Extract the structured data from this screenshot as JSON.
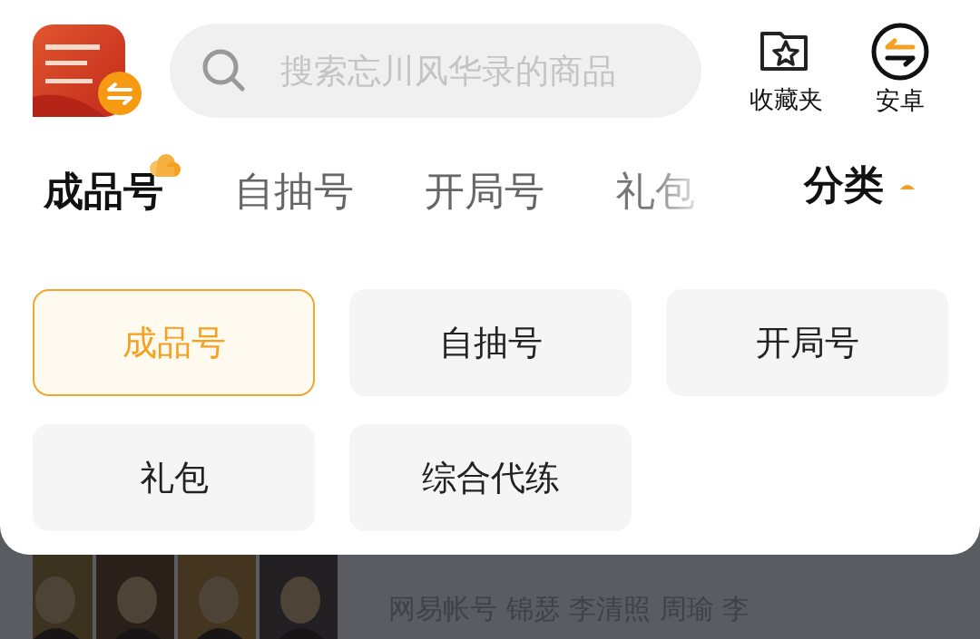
{
  "header": {
    "search": {
      "placeholder": "搜索忘川风华录的商品"
    },
    "actions": [
      {
        "kind": "favorites",
        "label": "收藏夹"
      },
      {
        "kind": "switch",
        "label": "安卓"
      }
    ]
  },
  "tabs": [
    {
      "label": "成品号",
      "selected": true
    },
    {
      "label": "自抽号",
      "selected": false
    },
    {
      "label": "开局号",
      "selected": false
    },
    {
      "label": "礼包",
      "selected": false
    }
  ],
  "category_toggle": {
    "label": "分类",
    "expanded": true
  },
  "category_options": [
    {
      "label": "成品号",
      "selected": true
    },
    {
      "label": "自抽号",
      "selected": false
    },
    {
      "label": "开局号",
      "selected": false
    },
    {
      "label": "礼包",
      "selected": false
    },
    {
      "label": "综合代练",
      "selected": false
    }
  ],
  "background_listing": {
    "tags": "网易帐号 锦瑟 李清照 周瑜 李"
  }
}
